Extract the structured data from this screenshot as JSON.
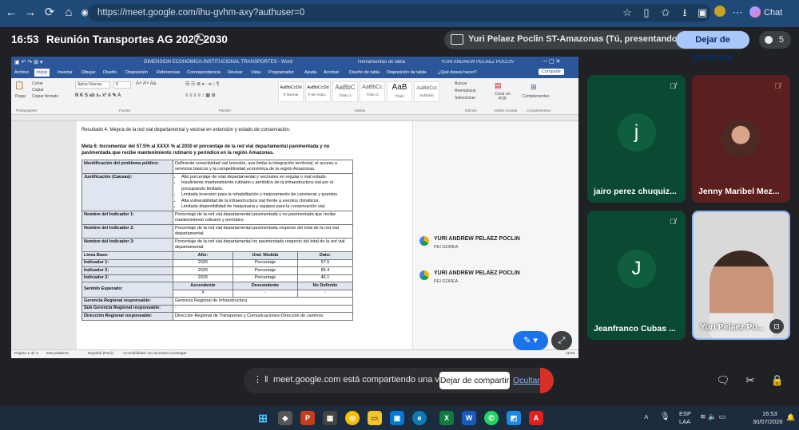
{
  "browser": {
    "url": "https://meet.google.com/ihu-gvhm-axy?authuser=0",
    "chat_label": "Chat"
  },
  "meet": {
    "time": "16:53",
    "meeting_title": "Reunión Transportes AG 2027-2030",
    "presenting_text": "Yuri Pelaez Poclin ST-Amazonas (Tú, presentando y anotando)",
    "stop_presenting_label": "Dejar de presentar",
    "participant_count": "5"
  },
  "word": {
    "title": "DIMENSION ECONÓMICA-INSTITUCIONAL TRANSPORTES  -  Word",
    "context_tab": "Herramientas de tabla",
    "user": "YURI ANDREW PELAEZ POCLIN",
    "tabs": [
      "Archivo",
      "Inicio",
      "Insertar",
      "Dibujar",
      "Diseño",
      "Disposición",
      "Referencias",
      "Correspondencia",
      "Revisar",
      "Vista",
      "Programador",
      "Ayuda",
      "Acrobat",
      "Diseño de tabla",
      "Disposición de tabla",
      "¿Qué desea hacer?",
      "Compartir"
    ],
    "ribbon": {
      "paste": "Pegar",
      "cut": "Cortar",
      "copy": "Copiar",
      "format_painter": "Copiar formato",
      "font": "Aptos Narrow",
      "size": "8",
      "styles": [
        {
          "sample": "AaBbCcDd",
          "name": "¶ Normal"
        },
        {
          "sample": "AaBbCcDd",
          "name": "¶ Sin espa..."
        },
        {
          "sample": "AaBbC",
          "name": "Título 1"
        },
        {
          "sample": "AaBbCc",
          "name": "Título 2"
        },
        {
          "sample": "AaB",
          "name": "Título"
        },
        {
          "sample": "AaBbCcl",
          "name": "Subtítulo"
        }
      ],
      "find": "Buscar",
      "replace": "Reemplazar",
      "select": "Seleccionar",
      "create_pdf": "Crear un PDF",
      "addins": "Complementos",
      "groups": [
        "Portapapeles",
        "Fuente",
        "Párrafo",
        "Estilos",
        "Edición",
        "Adobe Acrobat",
        "Complementos"
      ]
    },
    "doc": {
      "result": "Resultado 4. Mejora de la red vial departamental y vecinal en extensión y estado de conservación.",
      "meta_line1": "Meta 6: Incrementar del 57.5% al XXXX % al 2030 el porcentaje de la red vial departamental pavimentada y no",
      "meta_line2": "pavimentada que recibe mantenimiento rutinario y periódico en la región Amazonas.",
      "problem_label": "Identificación del problema público:",
      "problem_text": "Deficiente conectividad vial terrestre, que limita la integración territorial, el acceso a servicios básicos y la competitividad económica de la región Amazonas.",
      "justif_label": "Justificación (Causas):",
      "causes": [
        "Alto porcentaje de vías departamental y vecinales en regular o mal estado.",
        "Insuficiente mantenimiento rutinario y periódico de la infraestructura vial por el presupuesto limitado.",
        "Limitada inversión para la rehabilitación y mejoramiento de carreteras y puentes.",
        "Alta vulnerabilidad de la infraestructura vial frente a eventos climáticos.",
        "Limitada disponibilidad de maquinaria y equipos para la conservación vial."
      ],
      "ind1_label": "Nombre del Indicador 1:",
      "ind1_text": "Porcentaje de la red vial departamental pavimentada y no pavimentada que recibe mantenimiento rutinario y periódico.",
      "ind2_label": "Nombre del Indicador 2:",
      "ind2_text": "Porcentaje de la red vial departamental pavimentada respecto del total de la red vial departamental.",
      "ind3_label": "Nombre del Indicador 3:",
      "ind3_text": "Porcentaje de la red vial departamental no pavimentada respecto del total de la red vial departamental.",
      "baseline_header": [
        "Línea Base:",
        "Año:",
        "Und. Medida",
        "Dato:"
      ],
      "baseline_rows": [
        [
          "Indicador 1:",
          "2026",
          "Porcentaje",
          "57.5"
        ],
        [
          "Indicador 2:",
          "2026",
          "Porcentaje",
          "85.4"
        ],
        [
          "Indicador 3:",
          "2026",
          "Porcentaje",
          "46.1"
        ]
      ],
      "sense_label": "Sentido Esperado:",
      "sense_header": [
        "Ascendente",
        "Descendente",
        "No Definido"
      ],
      "sense_values": [
        "X",
        "-",
        "-"
      ],
      "gerencia_label": "Gerencia Regional responsable:",
      "gerencia_text": "Gerencia Regional de Infraestructura",
      "subgerencia_label": "Sub Gerencia Regional responsable:",
      "subgerencia_text": "-",
      "direccion_label": "Dirección Regional responsable:",
      "direccion_text": "Dirección Regional de Transportes y Comunicaciones-Dirección de caminos"
    },
    "comments": [
      {
        "name": "YURI ANDREW PELAEZ POCLIN",
        "sub": "PEI GOREA"
      },
      {
        "name": "YURI ANDREW PELAEZ POCLIN",
        "sub": "PEI GOREA"
      }
    ],
    "status": {
      "page": "Página 1 de 3",
      "words": "946 palabras",
      "lang": "Español (Perú)",
      "accessibility": "Accesibilidad: es necesario investigar",
      "zoom": "110%"
    }
  },
  "participants": [
    {
      "initial": "j",
      "name": "jairo perez chuquiz...",
      "bg": "#0b4a32",
      "circle": "#0f5e3f"
    },
    {
      "initial": "",
      "name": "Jenny Maribel Mez...",
      "bg": "#5b1f1f",
      "circle": ""
    },
    {
      "initial": "J",
      "name": "Jeanfranco Cubas ...",
      "bg": "#0b4a32",
      "circle": "#0f5e3f"
    },
    {
      "initial": "",
      "name": "Yuri Pelaez Po...",
      "bg": "#d9d9d9",
      "circle": ""
    }
  ],
  "share_bar": {
    "message": "meet.google.com está compartiendo una ventana.",
    "stop_label": "Dejar de compartir",
    "hide_label": "Ocultar"
  },
  "taskbar": {
    "lang_top": "ESP",
    "lang_bottom": "LAA",
    "clock_time": "16:53",
    "clock_date": "30/07/2026"
  }
}
